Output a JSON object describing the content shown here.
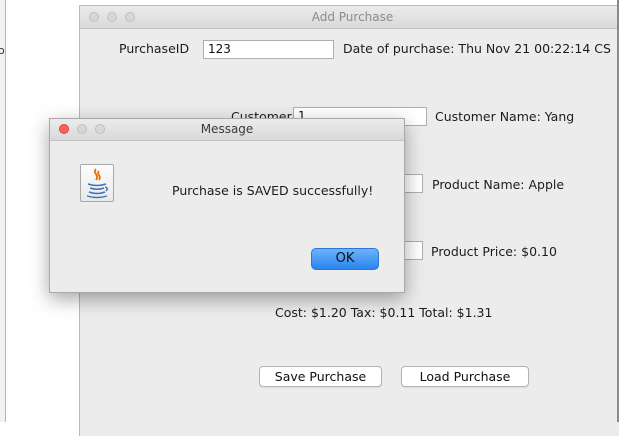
{
  "background_window": {
    "edge_text": "o"
  },
  "main_window": {
    "title": "Add Purchase",
    "purchase_id": {
      "label": "PurchaseID",
      "value": "123"
    },
    "date_of_purchase": "Date of purchase: Thu Nov 21 00:22:14 CS",
    "customer_id": {
      "label": "CustomerID",
      "value": "1"
    },
    "customer_name": "Customer Name: Yang",
    "product_name": "Product Name: Apple",
    "product_price": "Product Price: $0.10",
    "totals": "Cost: $1.20 Tax: $0.11 Total: $1.31",
    "save_button": "Save Purchase",
    "load_button": "Load Purchase"
  },
  "dialog": {
    "title": "Message",
    "message": "Purchase is SAVED successfully!",
    "ok_button": "OK",
    "icon": "java-icon"
  },
  "colors": {
    "close_light": "#fc605b",
    "ok_button": "#2a84f0",
    "java_blue": "#3b73b9",
    "java_orange": "#e76f00"
  }
}
